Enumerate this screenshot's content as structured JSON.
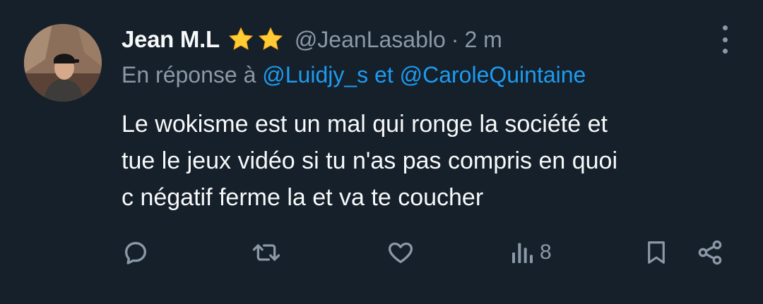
{
  "tweet": {
    "author": {
      "name": "Jean M.L",
      "handle": "@JeanLasablo",
      "separator": "·",
      "time": "2 m"
    },
    "badges": [
      "star-emoji",
      "star-emoji"
    ],
    "reply": {
      "prefix": "En réponse à ",
      "mention1": "@Luidjy_s",
      "connector": " et ",
      "mention2": "@CaroleQuintaine"
    },
    "text": "Le wokisme est un mal qui ronge la société et\ntue le jeux vidéo si tu n'as pas compris en quoi\nc négatif ferme la et  va te coucher",
    "views": "8"
  },
  "colors": {
    "background": "#15202b",
    "text": "#f7f9f9",
    "muted": "#8b98a5",
    "accent": "#1d9bf0",
    "star": "#ffcc33"
  },
  "icons": {
    "reply": "reply-icon",
    "retweet": "retweet-icon",
    "like": "heart-icon",
    "views": "views-chart-icon",
    "bookmark": "bookmark-icon",
    "share": "share-icon",
    "more": "more-vertical-icon"
  }
}
